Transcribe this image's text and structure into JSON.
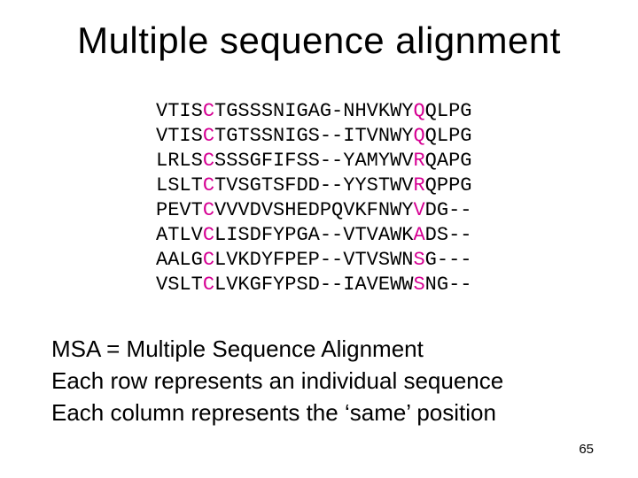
{
  "title": "Multiple sequence alignment",
  "alignment": {
    "highlight_columns": [
      4,
      22
    ],
    "rows": [
      "VTISCTGSSSNIGAG-NHVKWYQQLPG",
      "VTISCTGTSSNIGS--ITVNWYQQLPG",
      "LRLSCSSSGFIFSS--YAMYWVRQAPG",
      "LSLTCTVSGTSFDD--YYSTWVRQPPG",
      "PEVTCVVVDVSHEDPQVKFNWYVDG--",
      "ATLVCLISDFYPGA--VTVAWKADS--",
      "AALGCLVKDYFPEP--VTVSWNSG---",
      "VSLTCLVKGFYPSD--IAVEWWSNG--"
    ]
  },
  "description": {
    "line1": "MSA = Multiple Sequence Alignment",
    "line2": "Each row represents an individual sequence",
    "line3": "Each column represents the ‘same’ position"
  },
  "page_number": "65"
}
